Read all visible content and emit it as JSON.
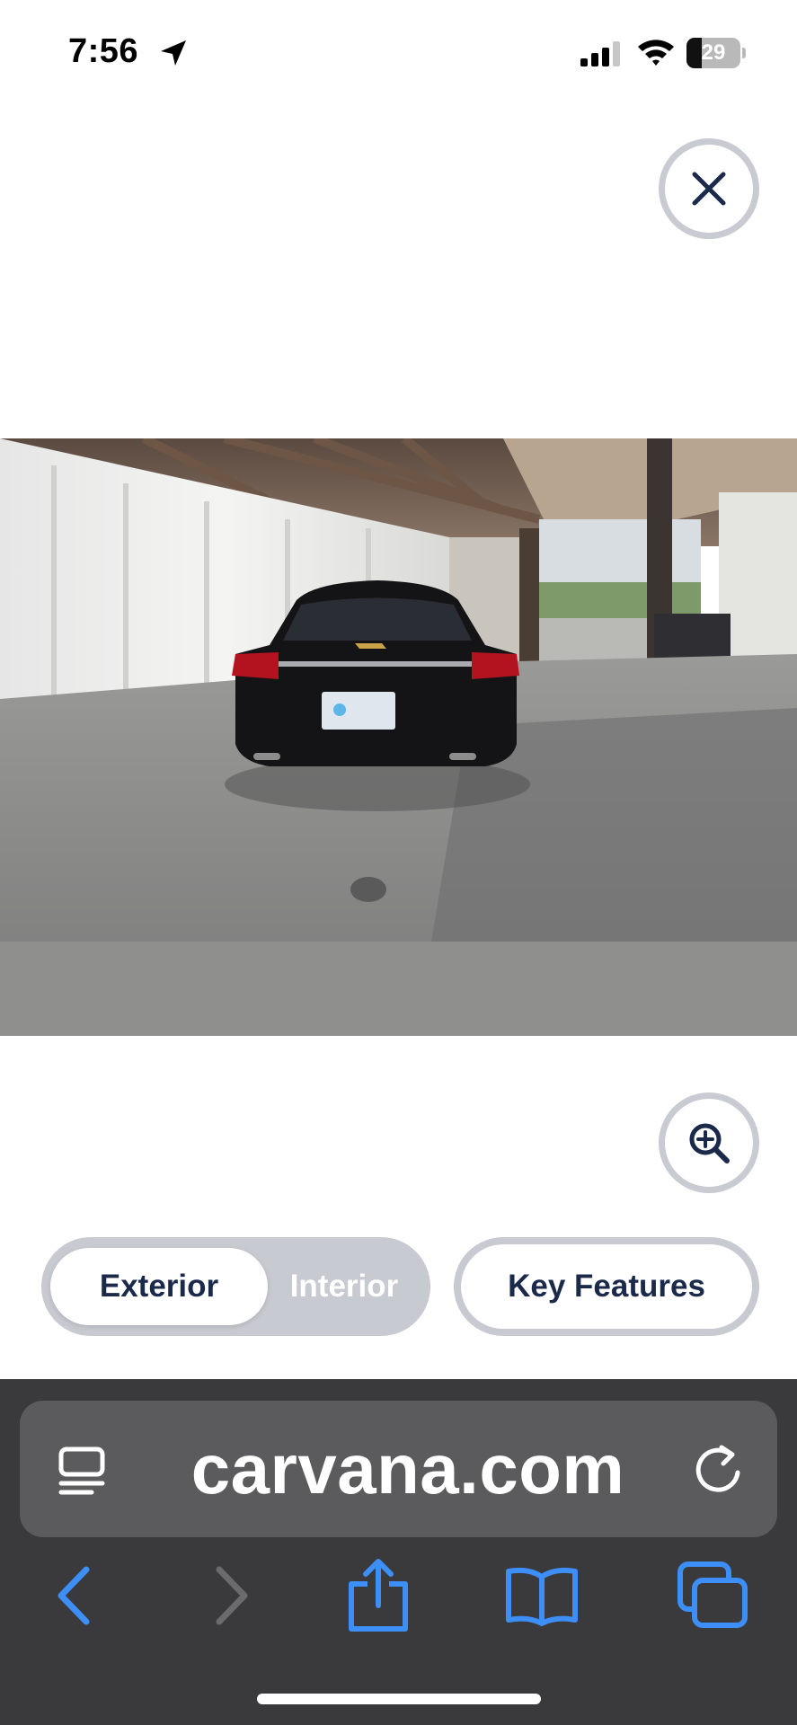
{
  "status_bar": {
    "time": "7:56",
    "battery_level": "29",
    "battery_fraction": 0.29
  },
  "viewer": {
    "close_icon": "close-icon",
    "zoom_icon": "zoom-in-icon",
    "photo_subject": "car-photo"
  },
  "tabs": {
    "exterior": "Exterior",
    "interior": "Interior",
    "selected": "Exterior"
  },
  "key_features": "Key Features",
  "browser": {
    "url": "carvana.com",
    "reader_icon": "reader-mode-icon",
    "reload_icon": "reload-icon",
    "toolbar_icons": [
      "back-icon",
      "forward-icon",
      "share-icon",
      "bookmarks-icon",
      "tabs-icon"
    ]
  },
  "colors": {
    "brand_navy": "#1b2a4a",
    "toggle_bg": "#c8cad1",
    "browser_bg": "#3a3a3c",
    "url_bar_bg": "#5b5b5e",
    "toolbar_blue": "#3d8ef7"
  }
}
